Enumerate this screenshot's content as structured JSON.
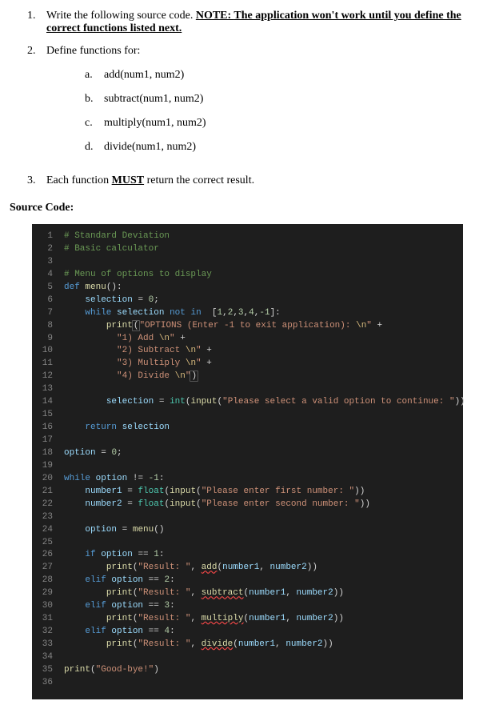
{
  "instructions": {
    "item1_num": "1.",
    "item1_text1": "Write the following source code. ",
    "item1_note_prefix": "NOTE: ",
    "item1_note_rest": "The application won't work until you define the correct functions listed next.",
    "item2_num": "2.",
    "item2_text": "Define functions for:",
    "subitems": [
      {
        "letter": "a.",
        "text": "add(num1, num2)"
      },
      {
        "letter": "b.",
        "text": "subtract(num1, num2)"
      },
      {
        "letter": "c.",
        "text": "multiply(num1, num2)"
      },
      {
        "letter": "d.",
        "text": "divide(num1, num2)"
      }
    ],
    "item3_num": "3.",
    "item3_text1": "Each function ",
    "item3_must": "MUST",
    "item3_text2": " return the correct result."
  },
  "sourcecode_label": "Source Code:",
  "code_lines": [
    {
      "n": "1",
      "html": "<span class='c-comment'># Standard Deviation</span>"
    },
    {
      "n": "2",
      "html": "<span class='c-comment'># Basic calculator</span>"
    },
    {
      "n": "3",
      "html": ""
    },
    {
      "n": "4",
      "html": "<span class='c-comment'># Menu of options to display</span>"
    },
    {
      "n": "5",
      "html": "<span class='c-keyword'>def</span> <span class='c-deffn'>menu</span><span class='c-punc'>():</span>"
    },
    {
      "n": "6",
      "html": "    <span class='c-var'>selection</span> <span class='c-op'>=</span> <span class='c-number'>0</span><span class='c-punc'>;</span>"
    },
    {
      "n": "7",
      "html": "    <span class='c-keyword'>while</span> <span class='c-var'>selection</span> <span class='c-keyword'>not in</span>  <span class='c-punc'>[</span><span class='c-number'>1</span><span class='c-punc'>,</span><span class='c-number'>2</span><span class='c-punc'>,</span><span class='c-number'>3</span><span class='c-punc'>,</span><span class='c-number'>4</span><span class='c-punc'>,</span><span class='c-number'>-1</span><span class='c-punc'>]:</span>"
    },
    {
      "n": "8",
      "html": "        <span class='c-func'>print</span><span class='c-punc bracket-hl'>(</span><span class='c-string'>\"OPTIONS (Enter -1 to exit application): <span class='c-esc'>\\n</span>\"</span> <span class='c-op'>+</span>"
    },
    {
      "n": "9",
      "html": "          <span class='c-string'>\"1) Add <span class='c-esc'>\\n</span>\"</span> <span class='c-op'>+</span>"
    },
    {
      "n": "10",
      "html": "          <span class='c-string'>\"2) Subtract <span class='c-esc'>\\n</span>\"</span> <span class='c-op'>+</span>"
    },
    {
      "n": "11",
      "html": "          <span class='c-string'>\"3) Multiply <span class='c-esc'>\\n</span>\"</span> <span class='c-op'>+</span>"
    },
    {
      "n": "12",
      "html": "          <span class='c-string'>\"4) Divide <span class='c-esc'>\\n</span>\"</span><span class='c-punc bracket-hl'>)</span>"
    },
    {
      "n": "13",
      "html": ""
    },
    {
      "n": "14",
      "html": "        <span class='c-var'>selection</span> <span class='c-op'>=</span> <span class='c-builtin'>int</span><span class='c-punc'>(</span><span class='c-func'>input</span><span class='c-punc'>(</span><span class='c-string'>\"Please select a valid option to continue: \"</span><span class='c-punc'>))</span>"
    },
    {
      "n": "15",
      "html": ""
    },
    {
      "n": "16",
      "html": "    <span class='c-keyword'>return</span> <span class='c-var'>selection</span>"
    },
    {
      "n": "17",
      "html": ""
    },
    {
      "n": "18",
      "html": "<span class='c-var'>option</span> <span class='c-op'>=</span> <span class='c-number'>0</span><span class='c-punc'>;</span>"
    },
    {
      "n": "19",
      "html": ""
    },
    {
      "n": "20",
      "html": "<span class='c-keyword'>while</span> <span class='c-var'>option</span> <span class='c-op'>!=</span> <span class='c-number'>-1</span><span class='c-punc'>:</span>"
    },
    {
      "n": "21",
      "html": "    <span class='c-var'>number1</span> <span class='c-op'>=</span> <span class='c-builtin'>float</span><span class='c-punc'>(</span><span class='c-func'>input</span><span class='c-punc'>(</span><span class='c-string'>\"Please enter first number: \"</span><span class='c-punc'>))</span>"
    },
    {
      "n": "22",
      "html": "    <span class='c-var'>number2</span> <span class='c-op'>=</span> <span class='c-builtin'>float</span><span class='c-punc'>(</span><span class='c-func'>input</span><span class='c-punc'>(</span><span class='c-string'>\"Please enter second number: \"</span><span class='c-punc'>))</span>"
    },
    {
      "n": "23",
      "html": ""
    },
    {
      "n": "24",
      "html": "    <span class='c-var'>option</span> <span class='c-op'>=</span> <span class='c-func'>menu</span><span class='c-punc'>()</span>"
    },
    {
      "n": "25",
      "html": ""
    },
    {
      "n": "26",
      "html": "    <span class='c-keyword'>if</span> <span class='c-var'>option</span> <span class='c-op'>==</span> <span class='c-number'>1</span><span class='c-punc'>:</span>"
    },
    {
      "n": "27",
      "html": "        <span class='c-func'>print</span><span class='c-punc'>(</span><span class='c-string'>\"Result: \"</span><span class='c-punc'>,</span> <span class='c-func squiggle'>add</span><span class='c-punc'>(</span><span class='c-var'>number1</span><span class='c-punc'>,</span> <span class='c-var'>number2</span><span class='c-punc'>))</span>"
    },
    {
      "n": "28",
      "html": "    <span class='c-keyword'>elif</span> <span class='c-var'>option</span> <span class='c-op'>==</span> <span class='c-number'>2</span><span class='c-punc'>:</span>"
    },
    {
      "n": "29",
      "html": "        <span class='c-func'>print</span><span class='c-punc'>(</span><span class='c-string'>\"Result: \"</span><span class='c-punc'>,</span> <span class='c-func squiggle'>subtract</span><span class='c-punc'>(</span><span class='c-var'>number1</span><span class='c-punc'>,</span> <span class='c-var'>number2</span><span class='c-punc'>))</span>"
    },
    {
      "n": "30",
      "html": "    <span class='c-keyword'>elif</span> <span class='c-var'>option</span> <span class='c-op'>==</span> <span class='c-number'>3</span><span class='c-punc'>:</span>"
    },
    {
      "n": "31",
      "html": "        <span class='c-func'>print</span><span class='c-punc'>(</span><span class='c-string'>\"Result: \"</span><span class='c-punc'>,</span> <span class='c-func squiggle'>multiply</span><span class='c-punc'>(</span><span class='c-var'>number1</span><span class='c-punc'>,</span> <span class='c-var'>number2</span><span class='c-punc'>))</span>"
    },
    {
      "n": "32",
      "html": "    <span class='c-keyword'>elif</span> <span class='c-var'>option</span> <span class='c-op'>==</span> <span class='c-number'>4</span><span class='c-punc'>:</span>"
    },
    {
      "n": "33",
      "html": "        <span class='c-func'>print</span><span class='c-punc'>(</span><span class='c-string'>\"Result: \"</span><span class='c-punc'>,</span> <span class='c-func squiggle'>divide</span><span class='c-punc'>(</span><span class='c-var'>number1</span><span class='c-punc'>,</span> <span class='c-var'>number2</span><span class='c-punc'>))</span>"
    },
    {
      "n": "34",
      "html": ""
    },
    {
      "n": "35",
      "html": "<span class='c-func'>print</span><span class='c-punc'>(</span><span class='c-string'>\"Good-bye!\"</span><span class='c-punc'>)</span>"
    },
    {
      "n": "36",
      "html": ""
    }
  ]
}
